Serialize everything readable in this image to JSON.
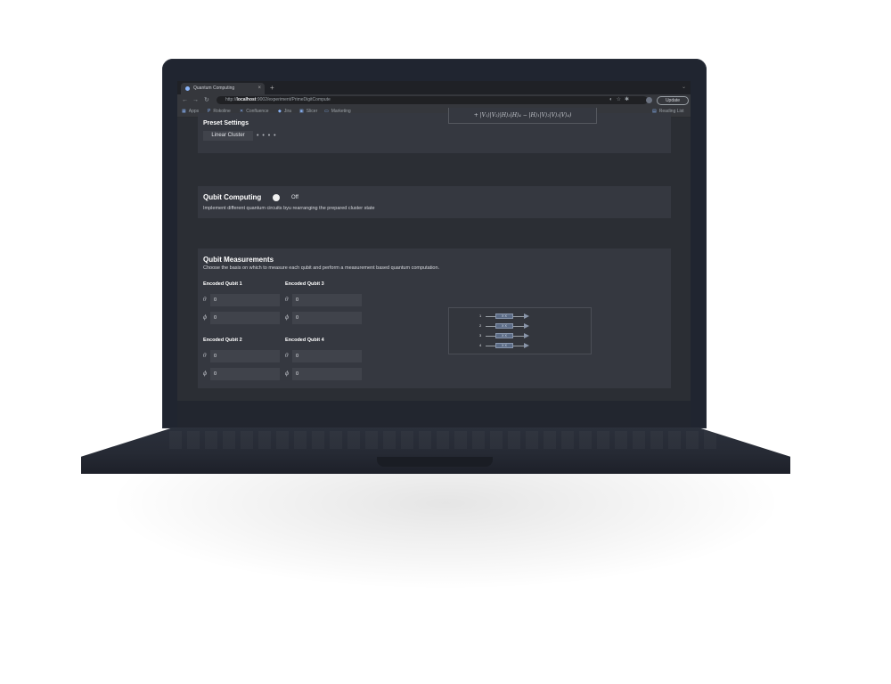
{
  "browser": {
    "tab_title": "Quantum Computing",
    "url_host": "localhost",
    "url_prefix": "http://",
    "url_path": ":9002/experiment/PrimeDigitCompute",
    "update_label": "Update",
    "bookmarks": [
      "Apps",
      "Rokoline",
      "Confluence",
      "Jira",
      "Slicer",
      "Marketing"
    ],
    "reading_list": "Reading List"
  },
  "preset": {
    "title": "Preset Settings",
    "button": "Linear Cluster",
    "dots": "• • • •",
    "formula": "+ |V₁⟩|V₂⟩|H⟩₃|H⟩₄ − |H⟩₁|V⟩₂|V⟩₃|V⟩₄)"
  },
  "computing": {
    "title": "Qubit Computing",
    "toggle_label": "Off",
    "description": "Implement different quantum circuits byu rearranging the prepared cluster state"
  },
  "measurements": {
    "title": "Qubit Measurements",
    "description": "Choose the basis on which to measure each qubit and perform a measurement based quantum computation.",
    "qubits": [
      {
        "label": "Encoded Qubit 1",
        "theta_symbol": "θ",
        "theta": "0",
        "phi_symbol": "ϕ",
        "phi": "0"
      },
      {
        "label": "Encoded Qubit 3",
        "theta_symbol": "θ",
        "theta": "0",
        "phi_symbol": "ϕ",
        "phi": "0"
      },
      {
        "label": "Encoded Qubit 2",
        "theta_symbol": "θ",
        "theta": "0",
        "phi_symbol": "ϕ",
        "phi": "0"
      },
      {
        "label": "Encoded Qubit 4",
        "theta_symbol": "θ",
        "theta": "0",
        "phi_symbol": "ϕ",
        "phi": "0"
      }
    ],
    "circuit": {
      "rows": [
        {
          "num": "1",
          "gate": "X  X"
        },
        {
          "num": "2",
          "gate": "X  X"
        },
        {
          "num": "3",
          "gate": "X  X"
        },
        {
          "num": "4",
          "gate": "X  X"
        }
      ]
    }
  }
}
